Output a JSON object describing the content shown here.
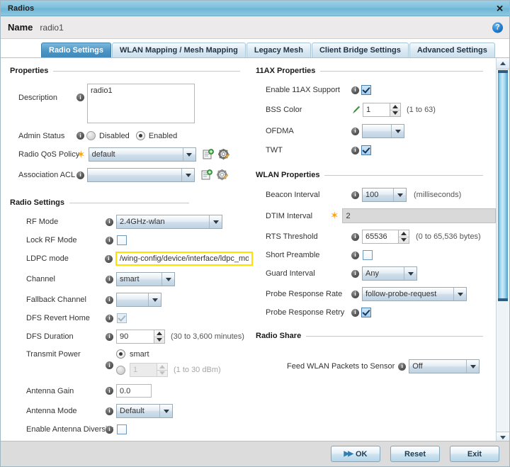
{
  "window": {
    "title": "Radios",
    "close_label": "✕",
    "name_label": "Name",
    "name_value": "radio1",
    "help_label": "?"
  },
  "tabs": [
    {
      "label": "Radio Settings",
      "active": true
    },
    {
      "label": "WLAN Mapping / Mesh Mapping",
      "active": false
    },
    {
      "label": "Legacy Mesh",
      "active": false
    },
    {
      "label": "Client Bridge Settings",
      "active": false
    },
    {
      "label": "Advanced Settings",
      "active": false
    }
  ],
  "properties": {
    "group_title": "Properties",
    "description_label": "Description",
    "description_value": "radio1",
    "admin_status_label": "Admin Status",
    "admin_disabled_label": "Disabled",
    "admin_enabled_label": "Enabled",
    "admin_status_selected": "Enabled",
    "radio_qos_label": "Radio QoS Policy",
    "radio_qos_value": "default",
    "association_acl_label": "Association ACL",
    "association_acl_value": ""
  },
  "radio_settings": {
    "group_title": "Radio Settings",
    "rf_mode_label": "RF Mode",
    "rf_mode_value": "2.4GHz-wlan",
    "lock_rf_mode_label": "Lock RF Mode",
    "lock_rf_mode_checked": false,
    "ldpc_mode_label": "LDPC mode",
    "ldpc_mode_value": "/wing-config/device/interface/ldpc_mode",
    "channel_label": "Channel",
    "channel_value": "smart",
    "fallback_channel_label": "Fallback Channel",
    "fallback_channel_value": "",
    "dfs_revert_home_label": "DFS Revert Home",
    "dfs_revert_home_checked": true,
    "dfs_duration_label": "DFS Duration",
    "dfs_duration_value": "90",
    "dfs_duration_hint": "(30 to 3,600 minutes)",
    "transmit_power_label": "Transmit Power",
    "transmit_power_smart_label": "smart",
    "transmit_power_selected": "smart",
    "transmit_power_value": "1",
    "transmit_power_hint": "(1 to 30 dBm)",
    "antenna_gain_label": "Antenna Gain",
    "antenna_gain_value": "0.0",
    "antenna_mode_label": "Antenna Mode",
    "antenna_mode_value": "Default",
    "antenna_diversity_label": "Enable Antenna Diversity",
    "antenna_diversity_checked": false
  },
  "ax_properties": {
    "group_title": "11AX Properties",
    "enable_11ax_label": "Enable 11AX Support",
    "enable_11ax_checked": true,
    "bss_color_label": "BSS Color",
    "bss_color_value": "1",
    "bss_color_hint": "(1 to 63)",
    "ofdma_label": "OFDMA",
    "ofdma_value": "",
    "twt_label": "TWT",
    "twt_checked": true
  },
  "wlan_properties": {
    "group_title": "WLAN Properties",
    "beacon_interval_label": "Beacon Interval",
    "beacon_interval_value": "100",
    "beacon_interval_hint": "(milliseconds)",
    "dtim_interval_label": "DTIM Interval",
    "dtim_interval_value": "2",
    "rts_threshold_label": "RTS Threshold",
    "rts_threshold_value": "65536",
    "rts_threshold_hint": "(0 to 65,536 bytes)",
    "short_preamble_label": "Short Preamble",
    "short_preamble_checked": false,
    "guard_interval_label": "Guard Interval",
    "guard_interval_value": "Any",
    "probe_response_rate_label": "Probe Response Rate",
    "probe_response_rate_value": "follow-probe-request",
    "probe_response_retry_label": "Probe Response Retry",
    "probe_response_retry_checked": true
  },
  "radio_share": {
    "group_title": "Radio Share",
    "feed_wlan_label": "Feed WLAN Packets to Sensor",
    "feed_wlan_value": "Off"
  },
  "footer": {
    "ok_label": "OK",
    "reset_label": "Reset",
    "exit_label": "Exit"
  },
  "colors": {
    "accent": "#4b94c4",
    "title_gradient_top": "#9dd0e6",
    "required_star": "#f5a623",
    "highlight_border": "#ffe000",
    "scroll_thumb": "#8fd0ea"
  }
}
